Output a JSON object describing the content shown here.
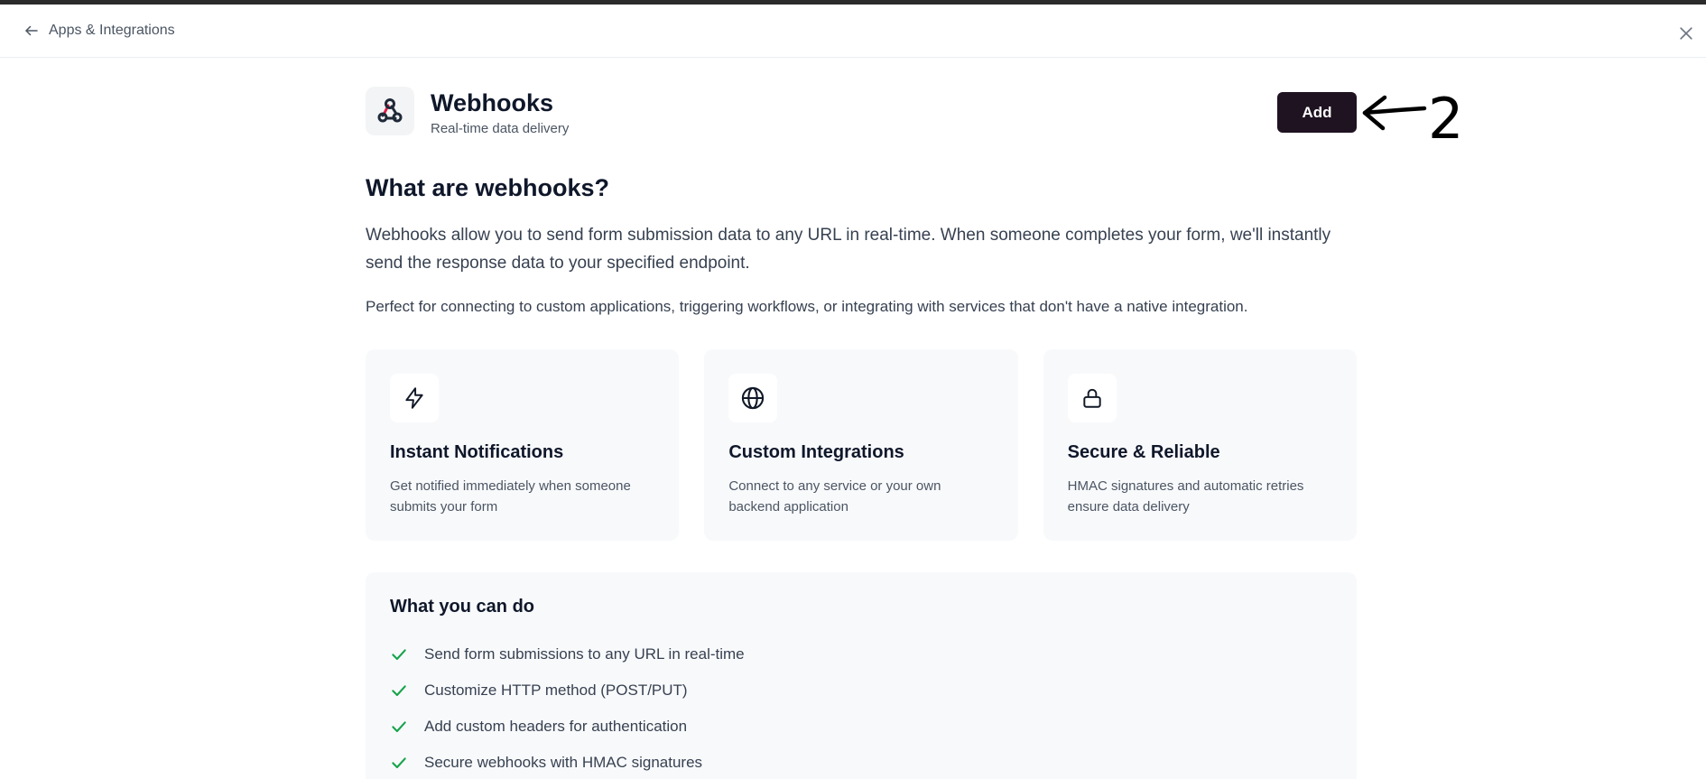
{
  "header": {
    "back_label": "Apps & Integrations",
    "back_icon": "arrow-left-icon",
    "close_icon": "close-icon"
  },
  "hero": {
    "title": "Webhooks",
    "subtitle": "Real-time data delivery",
    "logo_icon": "webhook-icon",
    "add_label": "Add",
    "annotation_number": "2"
  },
  "intro": {
    "heading": "What are webhooks?",
    "paragraph1": "Webhooks allow you to send form submission data to any URL in real-time. When someone completes your form, we'll instantly send the response data to your specified endpoint.",
    "paragraph2": "Perfect for connecting to custom applications, triggering workflows, or integrating with services that don't have a native integration."
  },
  "cards": [
    {
      "icon": "lightning-icon",
      "title": "Instant Notifications",
      "description": "Get notified immediately when someone submits your form"
    },
    {
      "icon": "globe-icon",
      "title": "Custom Integrations",
      "description": "Connect to any service or your own backend application"
    },
    {
      "icon": "lock-icon",
      "title": "Secure & Reliable",
      "description": "HMAC signatures and automatic retries ensure data delivery"
    }
  ],
  "features": {
    "title": "What you can do",
    "items": [
      {
        "label": "Send form submissions to any URL in real-time"
      },
      {
        "label": "Customize HTTP method (POST/PUT)"
      },
      {
        "label": "Add custom headers for authentication"
      },
      {
        "label": "Secure webhooks with HMAC signatures"
      }
    ]
  },
  "colors": {
    "accent": "#e11d48",
    "button_bg": "#1f1221",
    "check": "#16a34a",
    "card_bg": "#f8f9fb"
  }
}
